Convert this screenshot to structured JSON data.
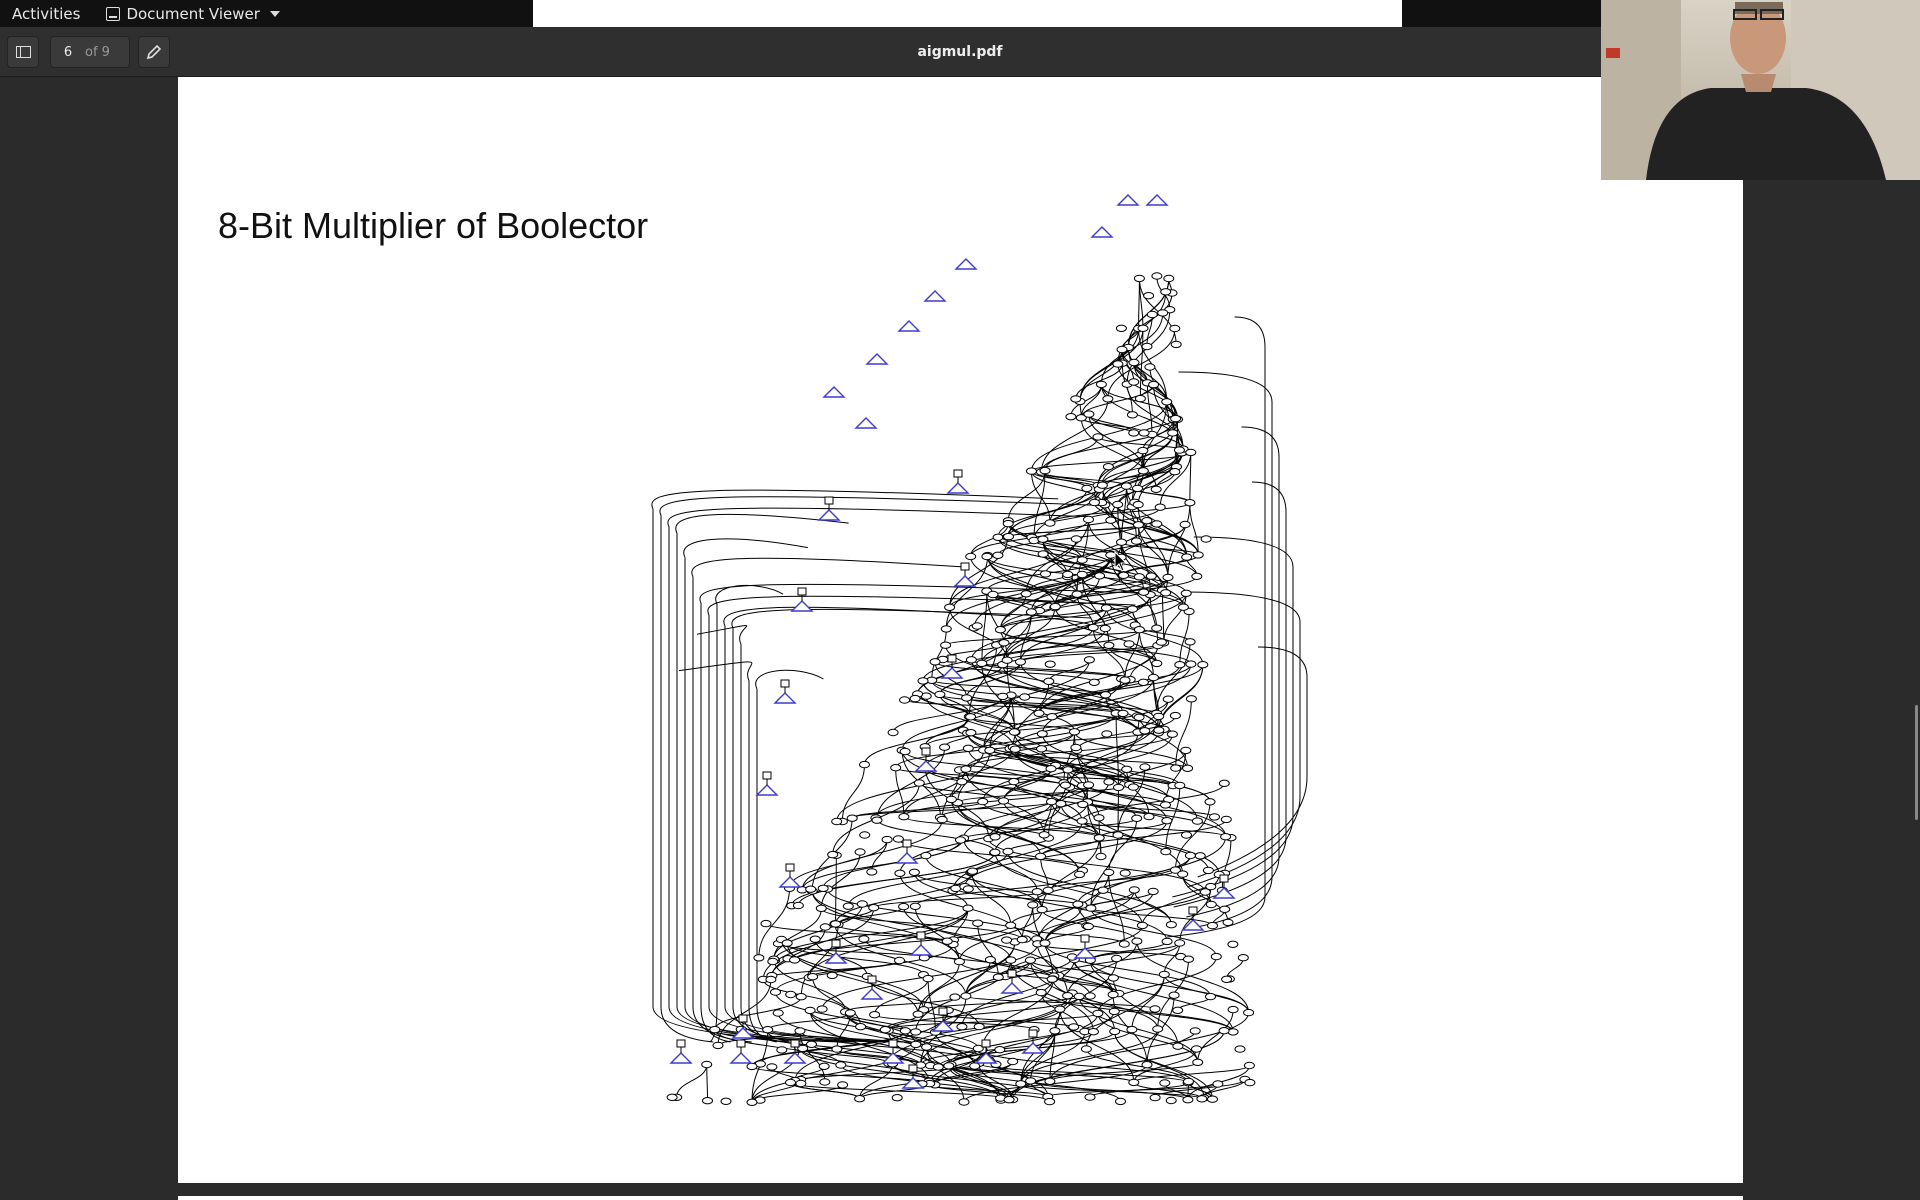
{
  "topbar": {
    "activities": "Activities",
    "app_name": "Document Viewer",
    "app_icon": "document-viewer-icon"
  },
  "headerbar": {
    "sidebar_toggle_icon": "sidebar-toggle-icon",
    "page_number": "6",
    "page_count": "of 9",
    "document_title": "aigmul.pdf",
    "annotate_icon": "pencil-annotate-icon"
  },
  "slide": {
    "title": "8-Bit Multiplier of Boolector"
  },
  "colors": {
    "topbar": "#111111",
    "headerbar": "#2f2f2f",
    "viewer_bg": "#2b2b2b",
    "node_blue": "#3c3cd0"
  },
  "webcam": {
    "description_icon": "presenter-video-feed"
  }
}
